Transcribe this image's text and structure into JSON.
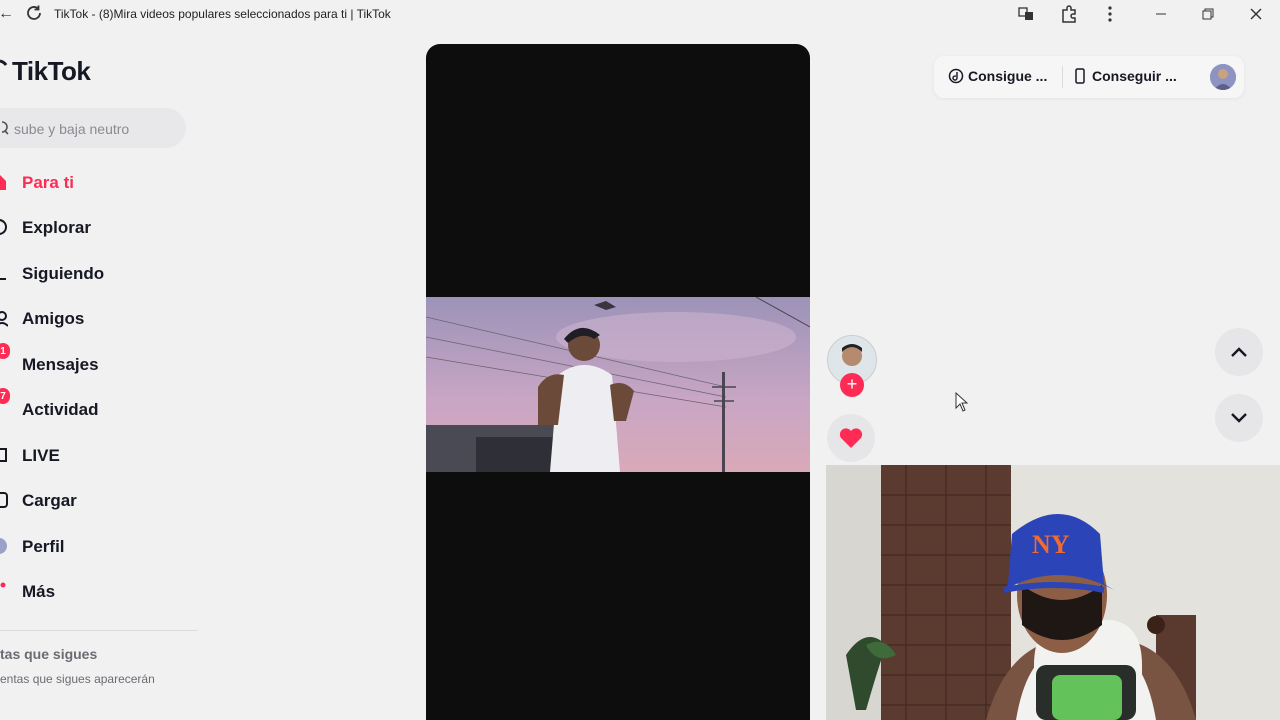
{
  "window": {
    "title": "TikTok - (8)Mira videos populares seleccionados para ti | TikTok",
    "back_icon": "back-arrow-icon",
    "reload_icon": "reload-icon",
    "controls": [
      "translate-icon",
      "extensions-icon",
      "more-vertical-icon",
      "minimize-icon",
      "restore-icon",
      "close-icon"
    ]
  },
  "brand": {
    "name": "TikTok",
    "color": "#fe2c55"
  },
  "search": {
    "placeholder": "sube y baja neutro"
  },
  "nav": [
    {
      "label": "Para ti",
      "icon": "home-icon",
      "active": true
    },
    {
      "label": "Explorar",
      "icon": "compass-icon"
    },
    {
      "label": "Siguiendo",
      "icon": "following-icon"
    },
    {
      "label": "Amigos",
      "icon": "friends-icon"
    },
    {
      "label": "Mensajes",
      "icon": "messages-icon",
      "badge": "1"
    },
    {
      "label": "Actividad",
      "icon": "activity-icon",
      "badge": "7"
    },
    {
      "label": "LIVE",
      "icon": "live-icon"
    },
    {
      "label": "Cargar",
      "icon": "upload-icon"
    },
    {
      "label": "Perfil",
      "icon": "profile-icon"
    },
    {
      "label": "Más",
      "icon": "more-icon"
    }
  ],
  "following": {
    "title": "tas que sigues",
    "note": "entas que sigues aparecerán"
  },
  "top_actions": {
    "coins_label": "Consigue ...",
    "app_label": "Conseguir ..."
  },
  "colors": {
    "accent": "#fe2c55",
    "background": "#f1f1f2"
  }
}
